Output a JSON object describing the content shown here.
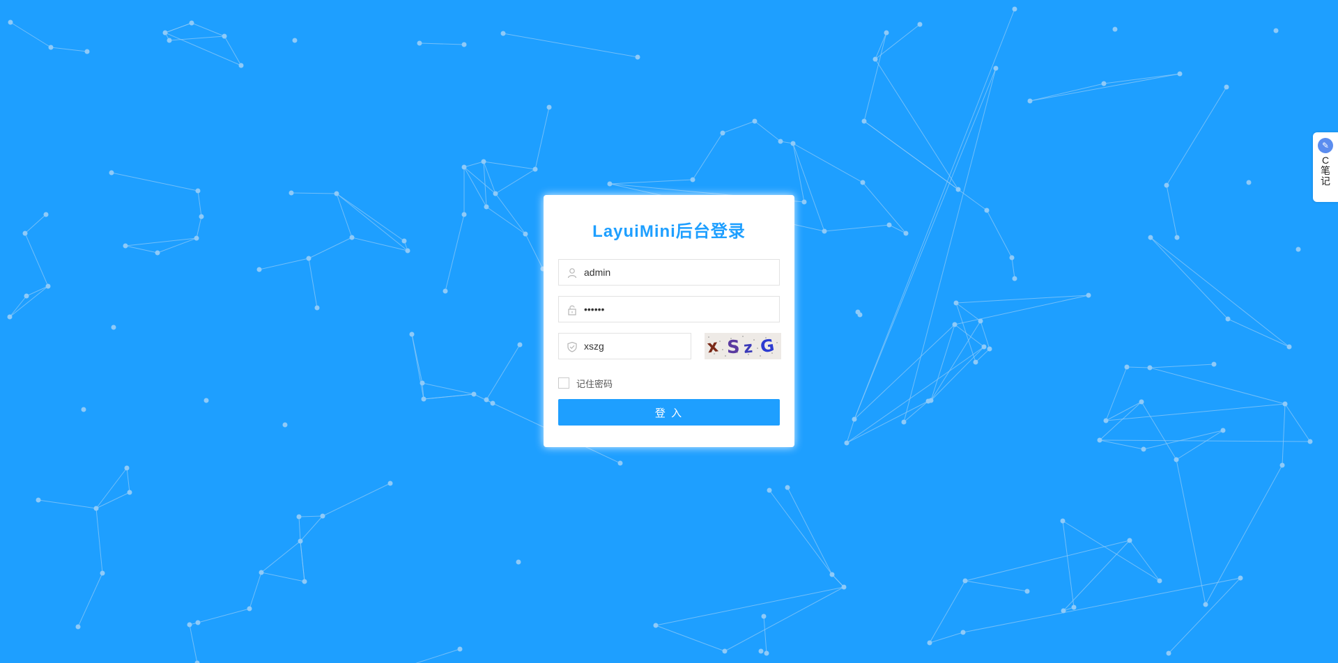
{
  "page": {
    "background_color": "#1e9fff",
    "accent_color": "#1e9fff"
  },
  "login": {
    "title": "LayuiMini后台登录",
    "username": {
      "value": "admin",
      "icon": "user-icon"
    },
    "password": {
      "value": "••••••",
      "icon": "lock-icon"
    },
    "captcha": {
      "value": "xszg",
      "icon": "shield-icon",
      "image_text": "xSzG"
    },
    "remember_label": "记住密码",
    "remember_checked": false,
    "submit_label": "登 入"
  },
  "side_widget": {
    "logo_icon": "note-logo-icon",
    "label": "C笔记"
  }
}
